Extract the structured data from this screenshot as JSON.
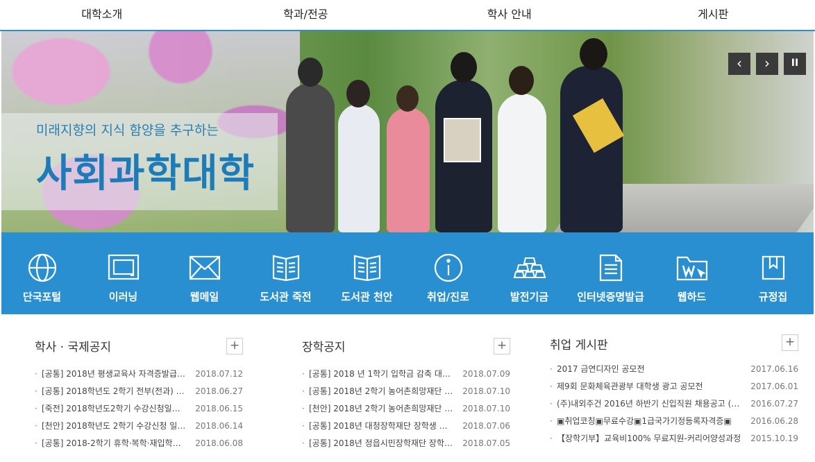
{
  "nav": [
    "대학소개",
    "학과/전공",
    "학사 안내",
    "게시판"
  ],
  "hero": {
    "tagline": "미래지향의 지식 함양을 추구하는",
    "headline": "사회과학대학",
    "prev": "‹",
    "next": "›",
    "pause": "II"
  },
  "quick_links": [
    {
      "label": "단국포털",
      "icon": "globe-icon"
    },
    {
      "label": "이러닝",
      "icon": "monitor-icon"
    },
    {
      "label": "웹메일",
      "icon": "mail-icon"
    },
    {
      "label": "도서관 죽전",
      "icon": "book-icon"
    },
    {
      "label": "도서관 천안",
      "icon": "book-icon"
    },
    {
      "label": "취업/진로",
      "icon": "info-icon"
    },
    {
      "label": "발전기금",
      "icon": "gold-bars-icon"
    },
    {
      "label": "인터넷증명발급",
      "icon": "document-icon"
    },
    {
      "label": "웹하드",
      "icon": "webhard-folder-icon"
    },
    {
      "label": "규정집",
      "icon": "bookmark-icon"
    }
  ],
  "boards": [
    {
      "title": "학사 · 국제공지",
      "more": "+",
      "items": [
        {
          "text": "[공통] 2018년 평생교육사 자격증발급…",
          "date": "2018.07.12"
        },
        {
          "text": "[공통] 2018학년도 2학기 전부(전과) …",
          "date": "2018.06.27"
        },
        {
          "text": "[죽전] 2018학년도2학기 수강신청일…",
          "date": "2018.06.15"
        },
        {
          "text": "[천안] 2018학년도 2학기 수강신청 일…",
          "date": "2018.06.14"
        },
        {
          "text": "[공통] 2018-2학기 휴학·복학·재입학…",
          "date": "2018.06.08"
        }
      ]
    },
    {
      "title": "장학공지",
      "more": "+",
      "items": [
        {
          "text": "[공통] 2018 년 1학기 입학금 감축 대…",
          "date": "2018.07.09"
        },
        {
          "text": "[공통] 2018년 2학기 농어촌희망재단 …",
          "date": "2018.07.10"
        },
        {
          "text": "[천안] 2018년 2학기 농어촌희망재단 …",
          "date": "2018.07.10"
        },
        {
          "text": "[공통] 2018년 대청장학재단 장학생 …",
          "date": "2018.07.06"
        },
        {
          "text": "[공통] 2018년 정읍시민장학재단 장학…",
          "date": "2018.07.05"
        }
      ]
    },
    {
      "title": "취업 게시판",
      "more": "+",
      "items": [
        {
          "text": "2017 금연디자인 공모전",
          "date": "2017.06.16"
        },
        {
          "text": "제9회 문화체육관광부 대학생 광고 공모전",
          "date": "2017.06.01"
        },
        {
          "text": "(주)내외주건 2016년 하반기 신입직원 채용공고 (…",
          "date": "2016.07.27"
        },
        {
          "text": "▣취업코칭▣무료수강▣1급국가기정등록자격증▣",
          "date": "2016.06.28"
        },
        {
          "text": "【장학기부】교육비100% 무료지원-커리어양성과정",
          "date": "2015.10.19"
        }
      ]
    }
  ]
}
